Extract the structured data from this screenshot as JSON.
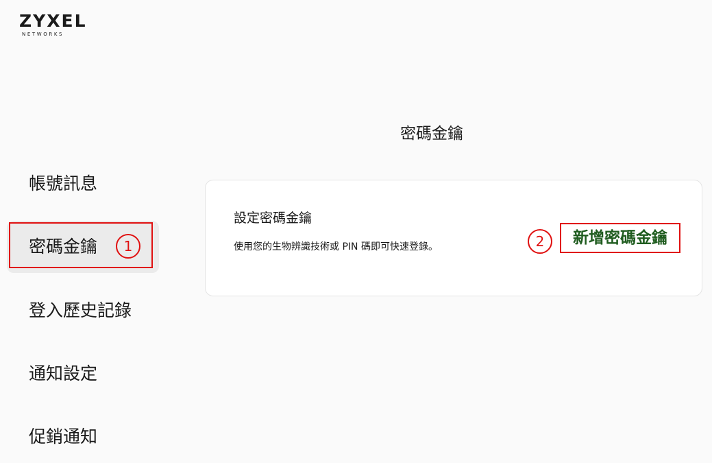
{
  "logo": {
    "brand": "ZYXEL",
    "sub": "NETWORKS"
  },
  "sidebar": {
    "items": [
      {
        "label": "帳號訊息",
        "active": false
      },
      {
        "label": "密碼金鑰",
        "active": true
      },
      {
        "label": "登入歷史記錄",
        "active": false
      },
      {
        "label": "通知設定",
        "active": false
      },
      {
        "label": "促銷通知",
        "active": false
      }
    ]
  },
  "annotations": {
    "step1": "1",
    "step2": "2",
    "color": "#e01010"
  },
  "main": {
    "title": "密碼金鑰",
    "card": {
      "title": "設定密碼金鑰",
      "description": "使用您的生物辨識技術或 PIN 碼即可快速登錄。",
      "action_label": "新增密碼金鑰",
      "action_color": "#1f5c1f"
    }
  }
}
